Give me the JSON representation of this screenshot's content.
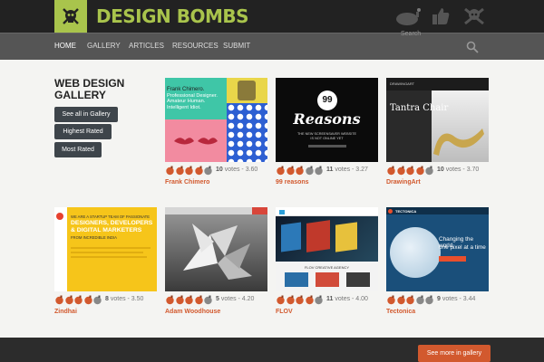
{
  "header": {
    "logo_text": "DESIGN BOMBS",
    "brand_color": "#a9c44c"
  },
  "nav": {
    "items": [
      {
        "label": "Home"
      },
      {
        "label": "Gallery"
      },
      {
        "label": "Articles"
      },
      {
        "label": "Resources"
      },
      {
        "label": "Submit"
      }
    ],
    "search_label": "Search"
  },
  "sidebar": {
    "title": "Web Design Gallery",
    "buttons": [
      {
        "label": "See all in Gallery"
      },
      {
        "label": "Highest Rated"
      },
      {
        "label": "Most Rated"
      }
    ]
  },
  "cards": [
    {
      "title": "Frank Chimero",
      "votes": "10",
      "score": "3.60",
      "rating": 4
    },
    {
      "title": "99 reasons",
      "votes": "11",
      "score": "3.27",
      "rating": 3
    },
    {
      "title": "DrawingArt",
      "votes": "10",
      "score": "3.70",
      "rating": 4
    },
    {
      "title": "Zindhai",
      "votes": "8",
      "score": "3.50",
      "rating": 4
    },
    {
      "title": "Adam Woodhouse",
      "votes": "5",
      "score": "4.20",
      "rating": 4
    },
    {
      "title": "FLOV",
      "votes": "11",
      "score": "4.00",
      "rating": 4
    },
    {
      "title": "Tectonica",
      "votes": "9",
      "score": "3.44",
      "rating": 3
    }
  ],
  "thumbs": {
    "frank": {
      "line1": "Frank Chimero.",
      "line2": "Professional Designer.",
      "line3": "Amateur Human.",
      "line4": "Intelligent Idiot."
    },
    "reasons": {
      "big": "99",
      "word": "Reasons",
      "sub1": "THE NEW SCREENSAVER WEBSITE",
      "sub2": "IS NOT ONLINE YET"
    },
    "drawing": {
      "brand": "DRAWINGART",
      "headline": "Tantra Chair"
    },
    "zindhai": {
      "l1": "WE ARE A STARTUP TEAM OF PASSIONATE",
      "l2": "DESIGNERS, DEVELOPERS",
      "l3": "& DIGITAL MARKETERS",
      "l4": "FROM INCREDIBLE INDIA"
    },
    "flov": {
      "caption": "FLOV CREATIVE AGENCY"
    },
    "tectonica": {
      "brand": "TECTONICA",
      "h1": "Changing the world",
      "h2": "one pixel at a time"
    }
  },
  "footer": {
    "see_more_label": "See more in gallery"
  },
  "colors": {
    "accent": "#d2592e",
    "bomb_filled": "#d2592e",
    "bomb_empty": "#888888"
  }
}
